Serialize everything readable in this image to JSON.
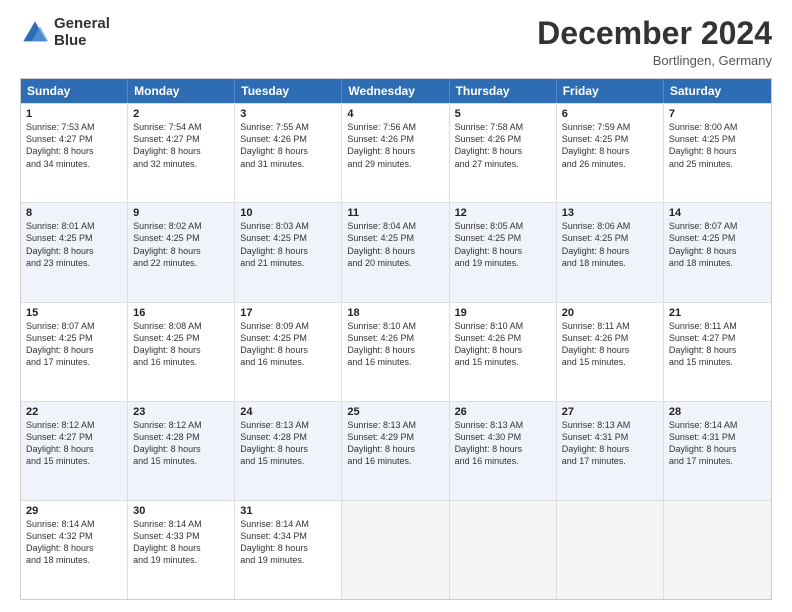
{
  "header": {
    "logo_line1": "General",
    "logo_line2": "Blue",
    "month": "December 2024",
    "location": "Bortlingen, Germany"
  },
  "weekdays": [
    "Sunday",
    "Monday",
    "Tuesday",
    "Wednesday",
    "Thursday",
    "Friday",
    "Saturday"
  ],
  "rows": [
    [
      {
        "day": "1",
        "lines": [
          "Sunrise: 7:53 AM",
          "Sunset: 4:27 PM",
          "Daylight: 8 hours",
          "and 34 minutes."
        ]
      },
      {
        "day": "2",
        "lines": [
          "Sunrise: 7:54 AM",
          "Sunset: 4:27 PM",
          "Daylight: 8 hours",
          "and 32 minutes."
        ]
      },
      {
        "day": "3",
        "lines": [
          "Sunrise: 7:55 AM",
          "Sunset: 4:26 PM",
          "Daylight: 8 hours",
          "and 31 minutes."
        ]
      },
      {
        "day": "4",
        "lines": [
          "Sunrise: 7:56 AM",
          "Sunset: 4:26 PM",
          "Daylight: 8 hours",
          "and 29 minutes."
        ]
      },
      {
        "day": "5",
        "lines": [
          "Sunrise: 7:58 AM",
          "Sunset: 4:26 PM",
          "Daylight: 8 hours",
          "and 27 minutes."
        ]
      },
      {
        "day": "6",
        "lines": [
          "Sunrise: 7:59 AM",
          "Sunset: 4:25 PM",
          "Daylight: 8 hours",
          "and 26 minutes."
        ]
      },
      {
        "day": "7",
        "lines": [
          "Sunrise: 8:00 AM",
          "Sunset: 4:25 PM",
          "Daylight: 8 hours",
          "and 25 minutes."
        ]
      }
    ],
    [
      {
        "day": "8",
        "lines": [
          "Sunrise: 8:01 AM",
          "Sunset: 4:25 PM",
          "Daylight: 8 hours",
          "and 23 minutes."
        ]
      },
      {
        "day": "9",
        "lines": [
          "Sunrise: 8:02 AM",
          "Sunset: 4:25 PM",
          "Daylight: 8 hours",
          "and 22 minutes."
        ]
      },
      {
        "day": "10",
        "lines": [
          "Sunrise: 8:03 AM",
          "Sunset: 4:25 PM",
          "Daylight: 8 hours",
          "and 21 minutes."
        ]
      },
      {
        "day": "11",
        "lines": [
          "Sunrise: 8:04 AM",
          "Sunset: 4:25 PM",
          "Daylight: 8 hours",
          "and 20 minutes."
        ]
      },
      {
        "day": "12",
        "lines": [
          "Sunrise: 8:05 AM",
          "Sunset: 4:25 PM",
          "Daylight: 8 hours",
          "and 19 minutes."
        ]
      },
      {
        "day": "13",
        "lines": [
          "Sunrise: 8:06 AM",
          "Sunset: 4:25 PM",
          "Daylight: 8 hours",
          "and 18 minutes."
        ]
      },
      {
        "day": "14",
        "lines": [
          "Sunrise: 8:07 AM",
          "Sunset: 4:25 PM",
          "Daylight: 8 hours",
          "and 18 minutes."
        ]
      }
    ],
    [
      {
        "day": "15",
        "lines": [
          "Sunrise: 8:07 AM",
          "Sunset: 4:25 PM",
          "Daylight: 8 hours",
          "and 17 minutes."
        ]
      },
      {
        "day": "16",
        "lines": [
          "Sunrise: 8:08 AM",
          "Sunset: 4:25 PM",
          "Daylight: 8 hours",
          "and 16 minutes."
        ]
      },
      {
        "day": "17",
        "lines": [
          "Sunrise: 8:09 AM",
          "Sunset: 4:25 PM",
          "Daylight: 8 hours",
          "and 16 minutes."
        ]
      },
      {
        "day": "18",
        "lines": [
          "Sunrise: 8:10 AM",
          "Sunset: 4:26 PM",
          "Daylight: 8 hours",
          "and 16 minutes."
        ]
      },
      {
        "day": "19",
        "lines": [
          "Sunrise: 8:10 AM",
          "Sunset: 4:26 PM",
          "Daylight: 8 hours",
          "and 15 minutes."
        ]
      },
      {
        "day": "20",
        "lines": [
          "Sunrise: 8:11 AM",
          "Sunset: 4:26 PM",
          "Daylight: 8 hours",
          "and 15 minutes."
        ]
      },
      {
        "day": "21",
        "lines": [
          "Sunrise: 8:11 AM",
          "Sunset: 4:27 PM",
          "Daylight: 8 hours",
          "and 15 minutes."
        ]
      }
    ],
    [
      {
        "day": "22",
        "lines": [
          "Sunrise: 8:12 AM",
          "Sunset: 4:27 PM",
          "Daylight: 8 hours",
          "and 15 minutes."
        ]
      },
      {
        "day": "23",
        "lines": [
          "Sunrise: 8:12 AM",
          "Sunset: 4:28 PM",
          "Daylight: 8 hours",
          "and 15 minutes."
        ]
      },
      {
        "day": "24",
        "lines": [
          "Sunrise: 8:13 AM",
          "Sunset: 4:28 PM",
          "Daylight: 8 hours",
          "and 15 minutes."
        ]
      },
      {
        "day": "25",
        "lines": [
          "Sunrise: 8:13 AM",
          "Sunset: 4:29 PM",
          "Daylight: 8 hours",
          "and 16 minutes."
        ]
      },
      {
        "day": "26",
        "lines": [
          "Sunrise: 8:13 AM",
          "Sunset: 4:30 PM",
          "Daylight: 8 hours",
          "and 16 minutes."
        ]
      },
      {
        "day": "27",
        "lines": [
          "Sunrise: 8:13 AM",
          "Sunset: 4:31 PM",
          "Daylight: 8 hours",
          "and 17 minutes."
        ]
      },
      {
        "day": "28",
        "lines": [
          "Sunrise: 8:14 AM",
          "Sunset: 4:31 PM",
          "Daylight: 8 hours",
          "and 17 minutes."
        ]
      }
    ],
    [
      {
        "day": "29",
        "lines": [
          "Sunrise: 8:14 AM",
          "Sunset: 4:32 PM",
          "Daylight: 8 hours",
          "and 18 minutes."
        ]
      },
      {
        "day": "30",
        "lines": [
          "Sunrise: 8:14 AM",
          "Sunset: 4:33 PM",
          "Daylight: 8 hours",
          "and 19 minutes."
        ]
      },
      {
        "day": "31",
        "lines": [
          "Sunrise: 8:14 AM",
          "Sunset: 4:34 PM",
          "Daylight: 8 hours",
          "and 19 minutes."
        ]
      },
      null,
      null,
      null,
      null
    ]
  ]
}
